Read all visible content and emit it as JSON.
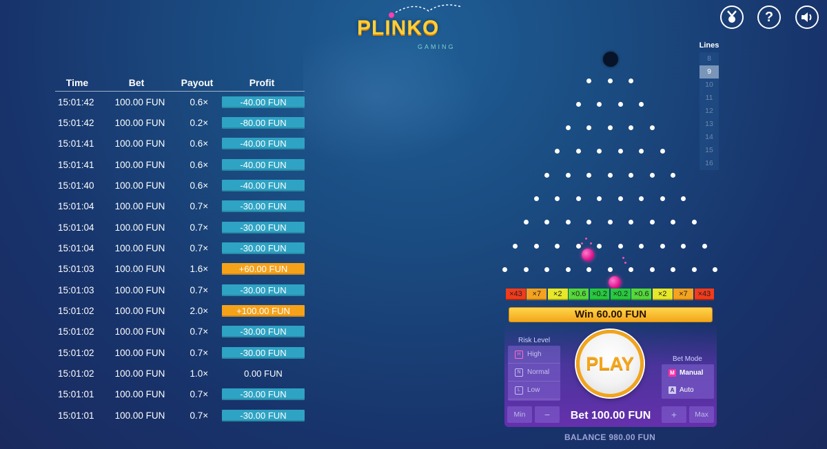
{
  "logo": {
    "title": "PLINKO",
    "subtitle": "GAMING"
  },
  "top_icons": [
    {
      "name": "medal-icon",
      "glyph": "☗"
    },
    {
      "name": "help-icon",
      "glyph": "?"
    },
    {
      "name": "sound-icon",
      "glyph": "🔊"
    }
  ],
  "history": {
    "headers": {
      "time": "Time",
      "bet": "Bet",
      "payout": "Payout",
      "profit": "Profit"
    },
    "rows": [
      {
        "time": "15:01:42",
        "bet": "100.00 FUN",
        "payout": "0.6×",
        "profit": "-40.00 FUN",
        "kind": "loss"
      },
      {
        "time": "15:01:42",
        "bet": "100.00 FUN",
        "payout": "0.2×",
        "profit": "-80.00 FUN",
        "kind": "loss"
      },
      {
        "time": "15:01:41",
        "bet": "100.00 FUN",
        "payout": "0.6×",
        "profit": "-40.00 FUN",
        "kind": "loss"
      },
      {
        "time": "15:01:41",
        "bet": "100.00 FUN",
        "payout": "0.6×",
        "profit": "-40.00 FUN",
        "kind": "loss"
      },
      {
        "time": "15:01:40",
        "bet": "100.00 FUN",
        "payout": "0.6×",
        "profit": "-40.00 FUN",
        "kind": "loss"
      },
      {
        "time": "15:01:04",
        "bet": "100.00 FUN",
        "payout": "0.7×",
        "profit": "-30.00 FUN",
        "kind": "loss"
      },
      {
        "time": "15:01:04",
        "bet": "100.00 FUN",
        "payout": "0.7×",
        "profit": "-30.00 FUN",
        "kind": "loss"
      },
      {
        "time": "15:01:04",
        "bet": "100.00 FUN",
        "payout": "0.7×",
        "profit": "-30.00 FUN",
        "kind": "loss"
      },
      {
        "time": "15:01:03",
        "bet": "100.00 FUN",
        "payout": "1.6×",
        "profit": "+60.00 FUN",
        "kind": "win"
      },
      {
        "time": "15:01:03",
        "bet": "100.00 FUN",
        "payout": "0.7×",
        "profit": "-30.00 FUN",
        "kind": "loss"
      },
      {
        "time": "15:01:02",
        "bet": "100.00 FUN",
        "payout": "2.0×",
        "profit": "+100.00 FUN",
        "kind": "win"
      },
      {
        "time": "15:01:02",
        "bet": "100.00 FUN",
        "payout": "0.7×",
        "profit": "-30.00 FUN",
        "kind": "loss"
      },
      {
        "time": "15:01:02",
        "bet": "100.00 FUN",
        "payout": "0.7×",
        "profit": "-30.00 FUN",
        "kind": "loss"
      },
      {
        "time": "15:01:02",
        "bet": "100.00 FUN",
        "payout": "1.0×",
        "profit": "0.00 FUN",
        "kind": "zero"
      },
      {
        "time": "15:01:01",
        "bet": "100.00 FUN",
        "payout": "0.7×",
        "profit": "-30.00 FUN",
        "kind": "loss"
      },
      {
        "time": "15:01:01",
        "bet": "100.00 FUN",
        "payout": "0.7×",
        "profit": "-30.00 FUN",
        "kind": "loss"
      }
    ]
  },
  "lines": {
    "title": "Lines",
    "options": [
      "8",
      "9",
      "10",
      "11",
      "12",
      "13",
      "14",
      "15",
      "16"
    ],
    "selected": "9"
  },
  "multipliers": [
    {
      "label": "×43",
      "color": "#f23b1b"
    },
    {
      "label": "×7",
      "color": "#f4a21f"
    },
    {
      "label": "×2",
      "color": "#e6e829"
    },
    {
      "label": "×0.6",
      "color": "#55d83a"
    },
    {
      "label": "×0.2",
      "color": "#27c93d"
    },
    {
      "label": "×0.2",
      "color": "#27c93d"
    },
    {
      "label": "×0.6",
      "color": "#55d83a"
    },
    {
      "label": "×2",
      "color": "#e6e829"
    },
    {
      "label": "×7",
      "color": "#f4a21f"
    },
    {
      "label": "×43",
      "color": "#f23b1b"
    }
  ],
  "win_text": "Win 60.00 FUN",
  "risk": {
    "title": "Risk Level",
    "options": [
      {
        "label": "High",
        "icon": "H",
        "selected": true
      },
      {
        "label": "Normal",
        "icon": "N",
        "selected": false
      },
      {
        "label": "Low",
        "icon": "L",
        "selected": false
      }
    ]
  },
  "play_label": "PLAY",
  "bet_mode": {
    "title": "Bet Mode",
    "options": [
      {
        "label": "Manual",
        "icon": "M",
        "selected": true
      },
      {
        "label": "Auto",
        "icon": "A",
        "selected": false
      }
    ]
  },
  "bet": {
    "min": "Min",
    "minus": "−",
    "text": "Bet 100.00 FUN",
    "plus": "+",
    "max": "Max"
  },
  "balance": "BALANCE 980.00 FUN",
  "colors": {
    "accent_orange": "#f5a21b",
    "loss_blue": "#2fa3c4",
    "ball_pink": "#e0168f"
  }
}
